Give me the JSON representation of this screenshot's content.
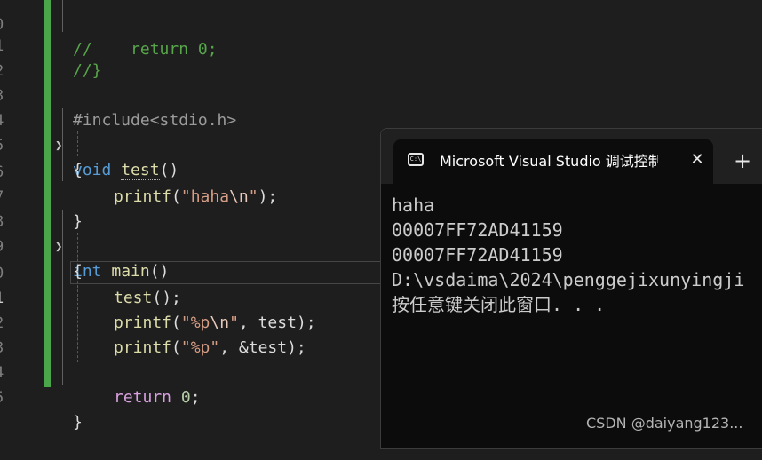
{
  "editor": {
    "lines": [
      {
        "num": "0",
        "text": "//    return 0;"
      },
      {
        "num": "1",
        "text": "//}"
      },
      {
        "num": "2",
        "text": ""
      },
      {
        "num": "3",
        "text": "#include<stdio.h>"
      },
      {
        "num": "4",
        "kw": "void",
        "fn": "test",
        "rest": "()"
      },
      {
        "num": "5",
        "text": "{"
      },
      {
        "num": "6",
        "fn": "printf",
        "open": "(",
        "str_a": "\"haha",
        "esc": "\\n",
        "str_b": "\"",
        "close": ");"
      },
      {
        "num": "7",
        "text": "}"
      },
      {
        "num": "8",
        "kw": "int",
        "fn": "main",
        "rest": "()"
      },
      {
        "num": "9",
        "text": "{"
      },
      {
        "num": "0",
        "fn": "test",
        "rest": "();"
      },
      {
        "num": "1",
        "fn": "printf",
        "open": "(",
        "str_a": "\"%p",
        "esc": "\\n",
        "str_b": "\"",
        "close": ", test);"
      },
      {
        "num": "2",
        "fn": "printf",
        "open": "(",
        "str": "\"%p\"",
        "close": ", &test);"
      },
      {
        "num": "3",
        "text": ""
      },
      {
        "num": "4",
        "ctrl": "return",
        "num_val": "0",
        "close": ";"
      },
      {
        "num": "5",
        "text": "}"
      }
    ]
  },
  "console": {
    "tab_title": "Microsoft Visual Studio 调试控制台",
    "close_glyph": "✕",
    "new_tab_glyph": "+",
    "icon_label": "C:\\",
    "output": [
      "haha",
      "00007FF72AD41159",
      "00007FF72AD41159",
      "D:\\vsdaima\\2024\\penggejixunyingji",
      "按任意键关闭此窗口. . ."
    ]
  },
  "watermark": "CSDN @daiyang123..."
}
